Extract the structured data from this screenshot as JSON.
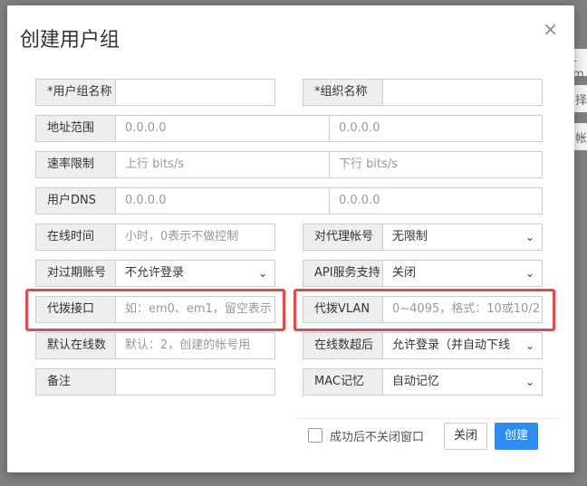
{
  "modal": {
    "title": "创建用户组",
    "close_glyph": "×"
  },
  "background": {
    "fragment_1": "-m",
    "fragment_2": "择",
    "fragment_3": "帐"
  },
  "fields": {
    "group_name": {
      "label": "*用户组名称",
      "value": ""
    },
    "org_name": {
      "label": "*组织名称",
      "value": ""
    },
    "address_range": {
      "label": "地址范围",
      "start_placeholder": "0.0.0.0",
      "end_placeholder": "0.0.0.0"
    },
    "rate_limit": {
      "label": "速率限制",
      "up_placeholder": "上行 bits/s",
      "down_placeholder": "下行 bits/s"
    },
    "user_dns": {
      "label": "用户DNS",
      "primary_placeholder": "0.0.0.0",
      "secondary_placeholder": "0.0.0.0"
    },
    "online_time": {
      "label": "在线时间",
      "placeholder": "小时，0表示不做控制"
    },
    "proxy_account": {
      "label": "对代理帐号",
      "selected": "无限制"
    },
    "expired_account": {
      "label": "对过期账号",
      "selected": "不允许登录"
    },
    "api_support": {
      "label": "API服务支持",
      "selected": "关闭"
    },
    "dial_interface": {
      "label": "代拨接口",
      "placeholder": "如：em0、em1，留空表示"
    },
    "dial_vlan": {
      "label": "代拨VLAN",
      "placeholder": "0~4095，格式：10或10/2"
    },
    "default_online": {
      "label": "默认在线数",
      "placeholder": "默认：2，创建的帐号用"
    },
    "online_exceed": {
      "label": "在线数超后",
      "selected": "允许登录（并自动下线"
    },
    "remark": {
      "label": "备注",
      "value": ""
    },
    "mac_memory": {
      "label": "MAC记忆",
      "selected": "自动记忆"
    }
  },
  "footer": {
    "keep_open_label": "成功后不关闭窗口",
    "close_button": "关闭",
    "create_button": "创建"
  },
  "colors": {
    "highlight": "#e5484d",
    "primary": "#2d8cf0"
  }
}
